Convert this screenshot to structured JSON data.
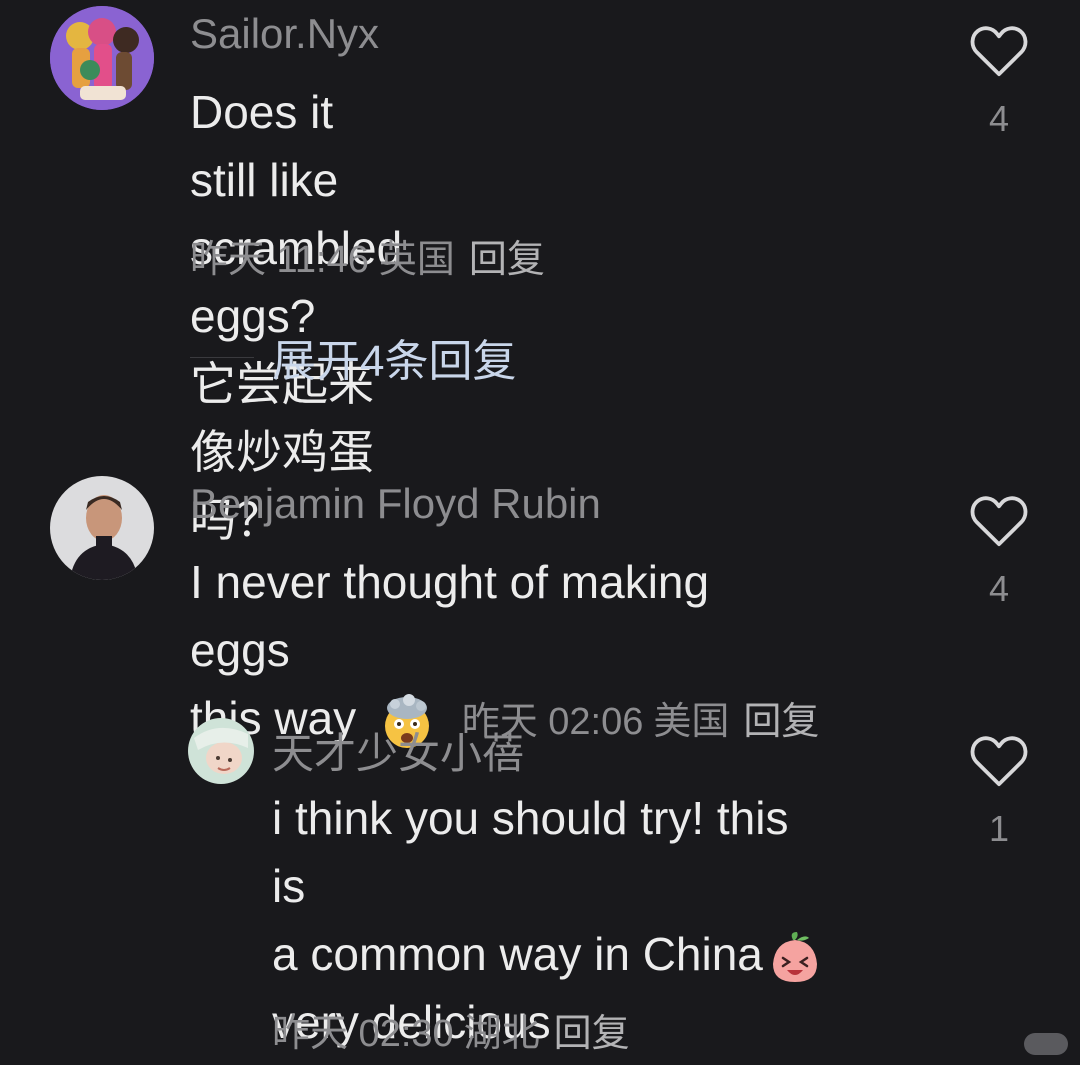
{
  "comments": [
    {
      "username": "Sailor.Nyx",
      "text_lines": [
        "Does it still like scrambled eggs?",
        "它尝起来像炒鸡蛋吗？"
      ],
      "time": "昨天 11:46",
      "location": "英国",
      "reply_label": "回复",
      "likes": "4",
      "expand_label": "展开4条回复"
    },
    {
      "username": "Benjamin Floyd Rubin",
      "text_line1": "I never thought of making eggs",
      "text_line2": "this way",
      "emoji": "exploding-head-emoji",
      "time": "昨天 02:06",
      "location": "美国",
      "reply_label": "回复",
      "likes": "4"
    },
    {
      "username": "天才少女小蓓",
      "text_lines": [
        "i think you should try!  this is",
        "a common way in China",
        "very delicious"
      ],
      "emoji": "laughing-peach-emoji",
      "time": "昨天 02:30",
      "location": "湖北",
      "reply_label": "回复",
      "likes": "1"
    }
  ],
  "colors": {
    "background": "#19191c",
    "text": "#ececec",
    "muted": "#8d8d90",
    "expand": "#c9d6ea"
  },
  "icons": {
    "like": "heart-outline-icon"
  }
}
